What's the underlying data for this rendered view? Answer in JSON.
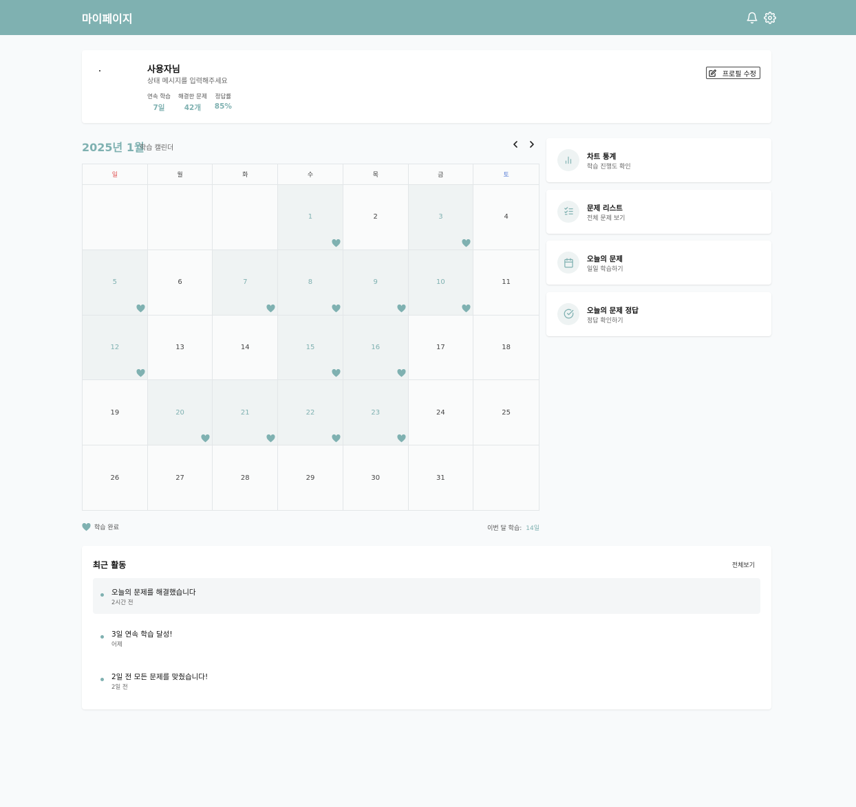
{
  "header": {
    "title": "마이페이지",
    "icons": [
      "bell-icon",
      "gear-icon"
    ]
  },
  "profile": {
    "name": "사용자님",
    "status": "상태 메시지를 입력해주세요",
    "stats": [
      {
        "label": "연속 학습",
        "value": "7일"
      },
      {
        "label": "해결한 문제",
        "value": "42개"
      },
      {
        "label": "정답률",
        "value": "85%"
      }
    ],
    "edit_label": "프로필 수정"
  },
  "calendar": {
    "title": "2025년 1월",
    "subtitle": "학습 캘린더",
    "weekdays": [
      "일",
      "월",
      "화",
      "수",
      "목",
      "금",
      "토"
    ],
    "days": [
      {
        "d": "",
        "done": false
      },
      {
        "d": "",
        "done": false
      },
      {
        "d": "",
        "done": false
      },
      {
        "d": "1",
        "done": true
      },
      {
        "d": "2",
        "done": false
      },
      {
        "d": "3",
        "done": true
      },
      {
        "d": "4",
        "done": false
      },
      {
        "d": "5",
        "done": true
      },
      {
        "d": "6",
        "done": false
      },
      {
        "d": "7",
        "done": true
      },
      {
        "d": "8",
        "done": true
      },
      {
        "d": "9",
        "done": true
      },
      {
        "d": "10",
        "done": true
      },
      {
        "d": "11",
        "done": false
      },
      {
        "d": "12",
        "done": true
      },
      {
        "d": "13",
        "done": false
      },
      {
        "d": "14",
        "done": false
      },
      {
        "d": "15",
        "done": true
      },
      {
        "d": "16",
        "done": true
      },
      {
        "d": "17",
        "done": false
      },
      {
        "d": "18",
        "done": false
      },
      {
        "d": "19",
        "done": false
      },
      {
        "d": "20",
        "done": true
      },
      {
        "d": "21",
        "done": true
      },
      {
        "d": "22",
        "done": true
      },
      {
        "d": "23",
        "done": true
      },
      {
        "d": "24",
        "done": false
      },
      {
        "d": "25",
        "done": false
      },
      {
        "d": "26",
        "done": false
      },
      {
        "d": "27",
        "done": false
      },
      {
        "d": "28",
        "done": false
      },
      {
        "d": "29",
        "done": false
      },
      {
        "d": "30",
        "done": false
      },
      {
        "d": "31",
        "done": false
      },
      {
        "d": "",
        "done": false
      }
    ],
    "legend_label": "학습 완료",
    "month_total_label": "이번 달 학습:",
    "month_total_value": "14일"
  },
  "menu": [
    {
      "title": "차트 통계",
      "sub": "학습 진행도 확인",
      "icon": "bar-chart-icon"
    },
    {
      "title": "문제 리스트",
      "sub": "전체 문제 보기",
      "icon": "checklist-icon"
    },
    {
      "title": "오늘의 문제",
      "sub": "일일 학습하기",
      "icon": "calendar-icon"
    },
    {
      "title": "오늘의 문제 정답",
      "sub": "정답 확인하기",
      "icon": "check-circle-icon"
    }
  ],
  "activity": {
    "title": "최근 활동",
    "view_all": "전체보기",
    "items": [
      {
        "title": "오늘의 문제를 해결했습니다",
        "time": "2시간 전"
      },
      {
        "title": "3일 연속 학습 달성!",
        "time": "어제"
      },
      {
        "title": "2일 전 모든 문제를 맞췄습니다!",
        "time": "2일 전"
      }
    ]
  },
  "colors": {
    "accent": "#7fb1b1",
    "sunday": "#e05252",
    "saturday": "#5a7fd6"
  }
}
